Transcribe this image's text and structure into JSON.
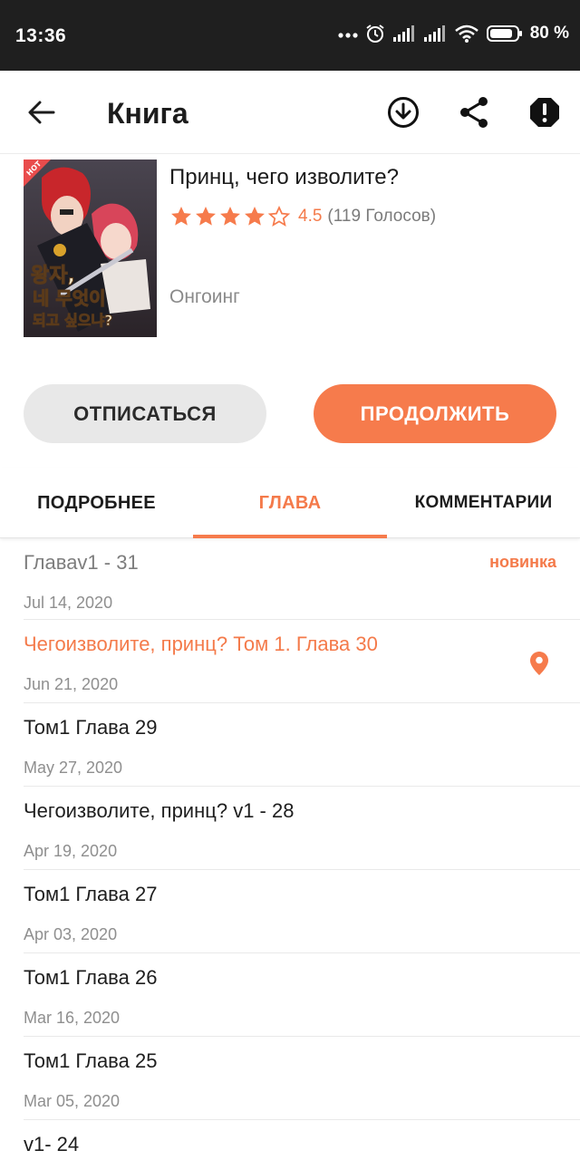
{
  "status_bar": {
    "time": "13:36",
    "battery": "80 %"
  },
  "app_bar": {
    "title": "Книга"
  },
  "book": {
    "title": "Принц, чего изволите?",
    "rating": "4.5",
    "rating_value": 4.5,
    "votes": "(119 Голосов)",
    "status": "Онгоинг",
    "cover_badge": "HOT"
  },
  "actions": {
    "unsubscribe": "ОТПИСАТЬСЯ",
    "continue": "ПРОДОЛЖИТЬ"
  },
  "tabs": [
    {
      "label": "ПОДРОБНЕЕ"
    },
    {
      "label": "ГЛАВА"
    },
    {
      "label": "КОММЕНТАРИИ"
    }
  ],
  "chapters": [
    {
      "title": "Главаv1 - 31",
      "date": "Jul 14, 2020",
      "badge": "новинка"
    },
    {
      "title": "Чегоизволите, принц? Том 1. Глава 30",
      "date": "Jun 21, 2020"
    },
    {
      "title": "Том1 Глава 29",
      "date": "May 27, 2020"
    },
    {
      "title": "Чегоизволите, принц? v1 - 28",
      "date": "Apr 19, 2020"
    },
    {
      "title": "Том1 Глава 27",
      "date": "Apr 03, 2020"
    },
    {
      "title": "Том1 Глава 26",
      "date": "Mar 16, 2020"
    },
    {
      "title": "Том1 Глава 25",
      "date": "Mar 05, 2020"
    },
    {
      "title": "v1- 24",
      "date": ""
    }
  ],
  "colors": {
    "accent": "#f67b4c",
    "accent_text": "#f47a4a",
    "status_bar": "#1f1f1f"
  },
  "icons": {
    "back": "arrow-left-icon",
    "download": "download-icon",
    "share": "share-icon",
    "report": "alert-icon",
    "bookmark": "location-pin-icon"
  }
}
